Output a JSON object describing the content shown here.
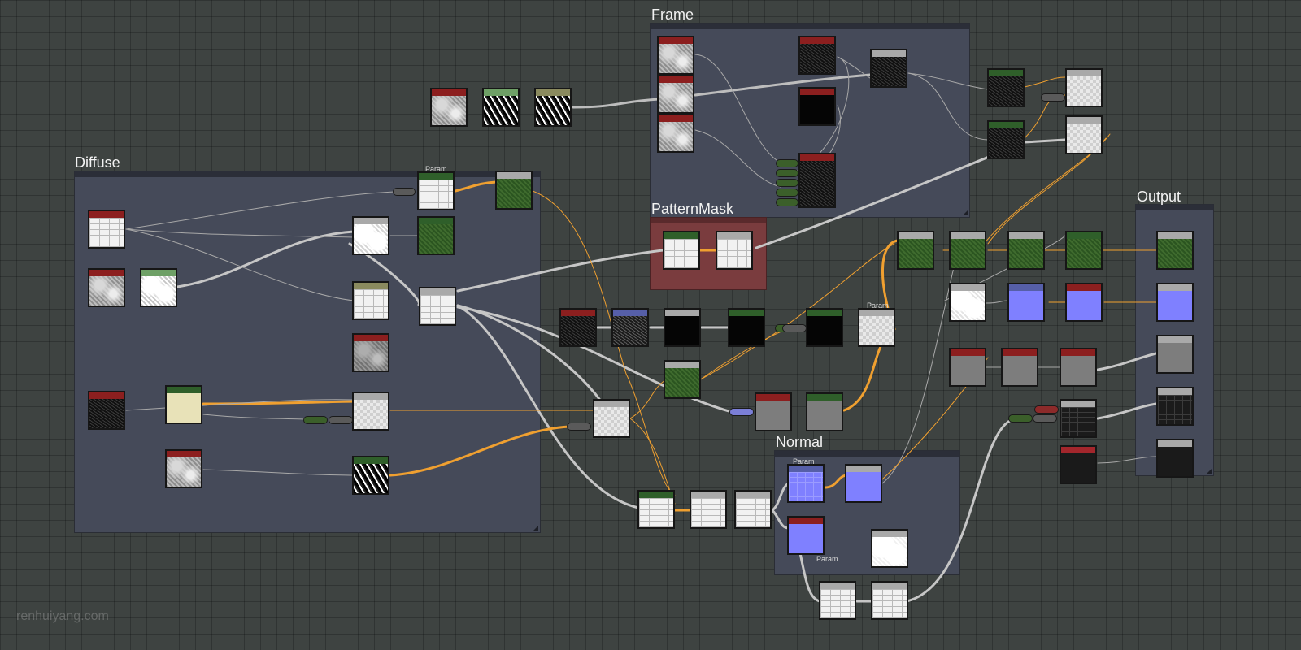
{
  "frames": {
    "frame": "Frame",
    "diffuse": "Diffuse",
    "pattern_mask": "PatternMask",
    "output": "Output",
    "normal": "Normal"
  },
  "param_labels": {
    "diffuse_param": "Param",
    "blend_param": "Param",
    "normal_param": "Param",
    "normal_bottom_param": "Param"
  },
  "watermark": "renhuiyang.com"
}
